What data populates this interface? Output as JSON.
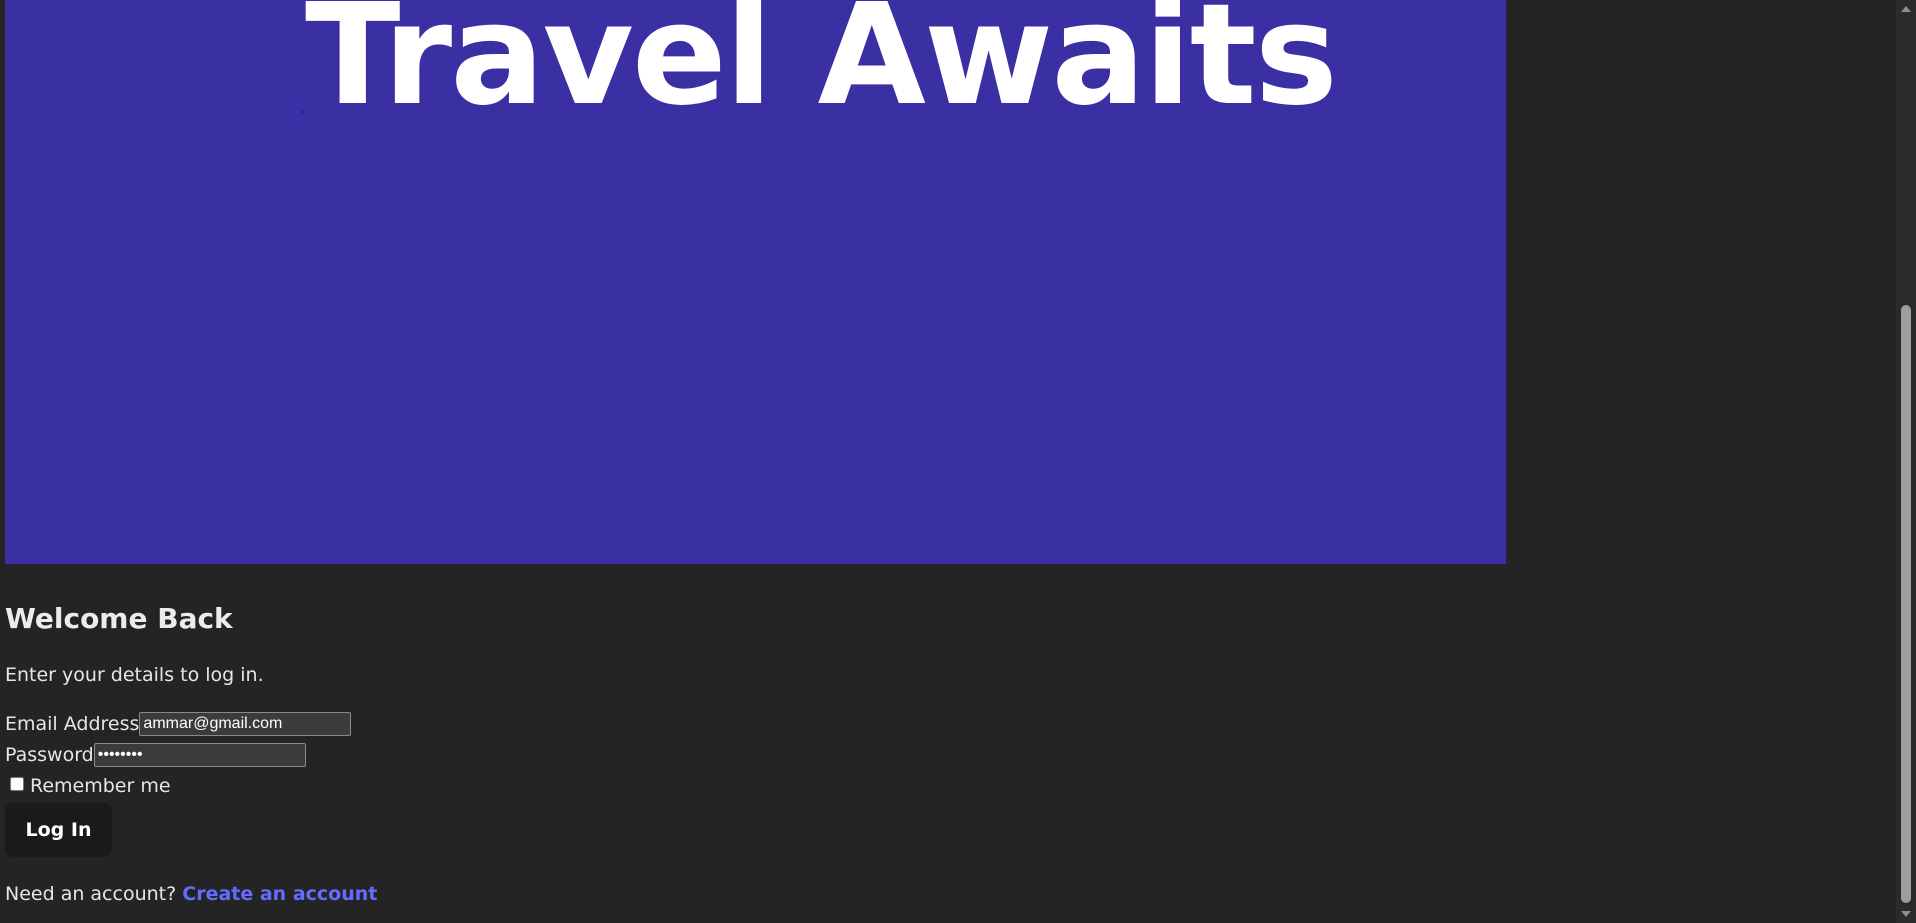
{
  "hero": {
    "title": "Travel Awaits",
    "background_color": "#3a30a3"
  },
  "login": {
    "heading": "Welcome Back",
    "subtitle": "Enter your details to log in.",
    "email_label": "Email Address",
    "email_value": "ammar@gmail.com",
    "password_label": "Password",
    "password_value": "••••••••",
    "remember_label": "Remember me",
    "remember_checked": false,
    "submit_label": "Log In",
    "signup_prompt": "Need an account?",
    "signup_link": "Create an account"
  },
  "colors": {
    "page_background": "#242424",
    "link": "#646cff",
    "button_background": "#1a1a1a"
  }
}
